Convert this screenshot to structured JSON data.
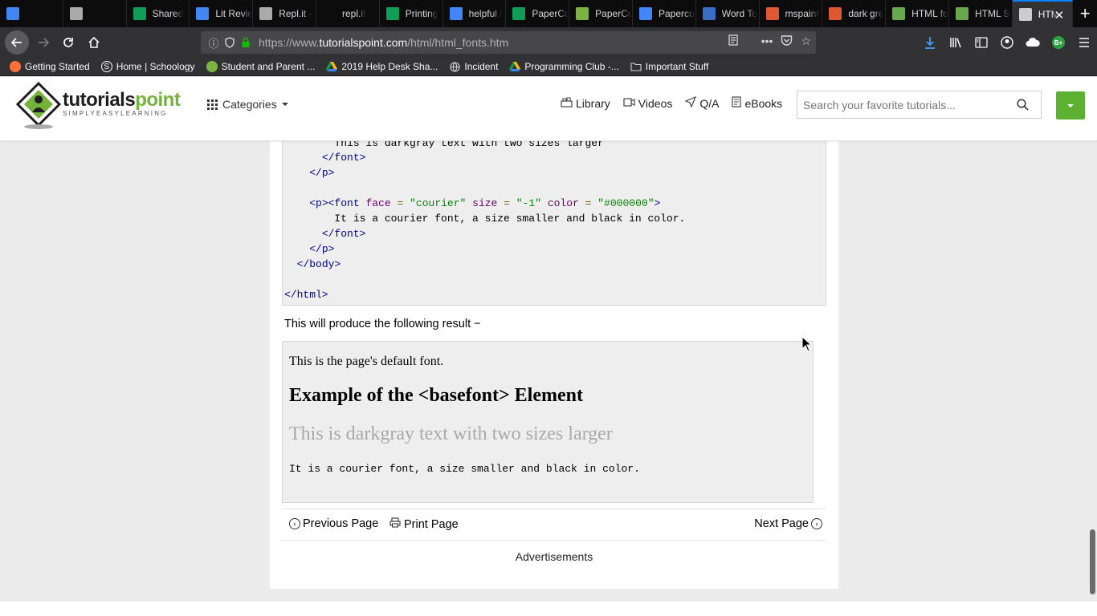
{
  "tabs": [
    {
      "title": "",
      "icon": "google-docs-icon",
      "color": "#4285f4"
    },
    {
      "title": "",
      "icon": "replit-icon",
      "color": "#aaaaaa"
    },
    {
      "title": "Shared",
      "icon": "google-drive-icon",
      "color": "#0f9d58"
    },
    {
      "title": "Lit Revie",
      "icon": "google-docs-icon",
      "color": "#4285f4"
    },
    {
      "title": "Repl.it -",
      "icon": "replit-icon",
      "color": "#aaaaaa"
    },
    {
      "title": "repl.it",
      "icon": "blank-icon",
      "color": "#0c0c0d"
    },
    {
      "title": "Printing",
      "icon": "google-drive-icon",
      "color": "#0f9d58"
    },
    {
      "title": "helpful l",
      "icon": "google-docs-icon",
      "color": "#4285f4"
    },
    {
      "title": "PaperCu",
      "icon": "google-sheets-icon",
      "color": "#0f9d58"
    },
    {
      "title": "PaperCu",
      "icon": "papercut-icon",
      "color": "#7cb342"
    },
    {
      "title": "Papercu",
      "icon": "google-docs-icon",
      "color": "#4285f4"
    },
    {
      "title": "Word To",
      "icon": "gear-app-icon",
      "color": "#3b6cc4"
    },
    {
      "title": "mspaint",
      "icon": "duckduckgo-icon",
      "color": "#de5833"
    },
    {
      "title": "dark gre",
      "icon": "duckduckgo-icon",
      "color": "#de5833"
    },
    {
      "title": "HTML fo",
      "icon": "chart-icon",
      "color": "#6aa84f"
    },
    {
      "title": "HTML S",
      "icon": "chart-icon",
      "color": "#6aa84f"
    },
    {
      "title": "HTML",
      "icon": "tutorialspoint-icon",
      "color": "#cccccc",
      "active": true
    }
  ],
  "navbar": {
    "url_prefix": "https://www.",
    "url_domain": "tutorialspoint.com",
    "url_path": "/html/html_fonts.htm"
  },
  "bookmarks": [
    {
      "label": "Getting Started",
      "icon": "firefox-icon",
      "color": "#ff7139"
    },
    {
      "label": "Home | Schoology",
      "icon": "schoology-icon",
      "color": "#ffffff"
    },
    {
      "label": "Student and Parent ...",
      "icon": "papercut-icon",
      "color": "#7cb342"
    },
    {
      "label": "2019 Help Desk Sha...",
      "icon": "google-drive-icon",
      "color": "#fbbc04"
    },
    {
      "label": "Incident",
      "icon": "globe-icon",
      "color": "#d7d7db"
    },
    {
      "label": "Programming Club -...",
      "icon": "google-drive-icon",
      "color": "#fbbc04"
    },
    {
      "label": "Important Stuff",
      "icon": "folder-icon",
      "color": "#d7d7db"
    }
  ],
  "header": {
    "logo_word_a": "tutorials",
    "logo_word_b": "point",
    "logo_tagline": "SIMPLYEASYLEARNING",
    "categories": "Categories",
    "nav": [
      {
        "label": "Library",
        "icon": "library-icon"
      },
      {
        "label": "Videos",
        "icon": "video-camera-icon"
      },
      {
        "label": "Q/A",
        "icon": "paper-plane-icon"
      },
      {
        "label": "eBooks",
        "icon": "ebook-icon"
      }
    ],
    "search_placeholder": "Search your favorite tutorials...",
    "brand_green": "#5db130"
  },
  "code": {
    "line1_text": "This is darkgray text with two sizes larger",
    "close_font": "</font>",
    "close_p": "</p>",
    "p_open": "<p>",
    "font_open": "<font",
    "attr_face": "face",
    "attr_size": "size",
    "attr_color": "color",
    "eq": "=",
    "val_face": "\"courier\"",
    "val_size": "\"-1\"",
    "val_color": "\"#000000\"",
    "gt": ">",
    "line_text": "It is a courier font, a size smaller and black in color.",
    "close_body": "</body>",
    "close_html": "</html>"
  },
  "result": {
    "label": "This will produce the following result −",
    "line1": "This is the page's default font.",
    "line2": "Example of the <basefont> Element",
    "line3": "This is darkgray text with two sizes larger",
    "line4": "It is a courier font, a size smaller and black in color."
  },
  "pager": {
    "previous": "Previous Page",
    "print": "Print Page",
    "next": "Next Page"
  },
  "advertisements": "Advertisements"
}
